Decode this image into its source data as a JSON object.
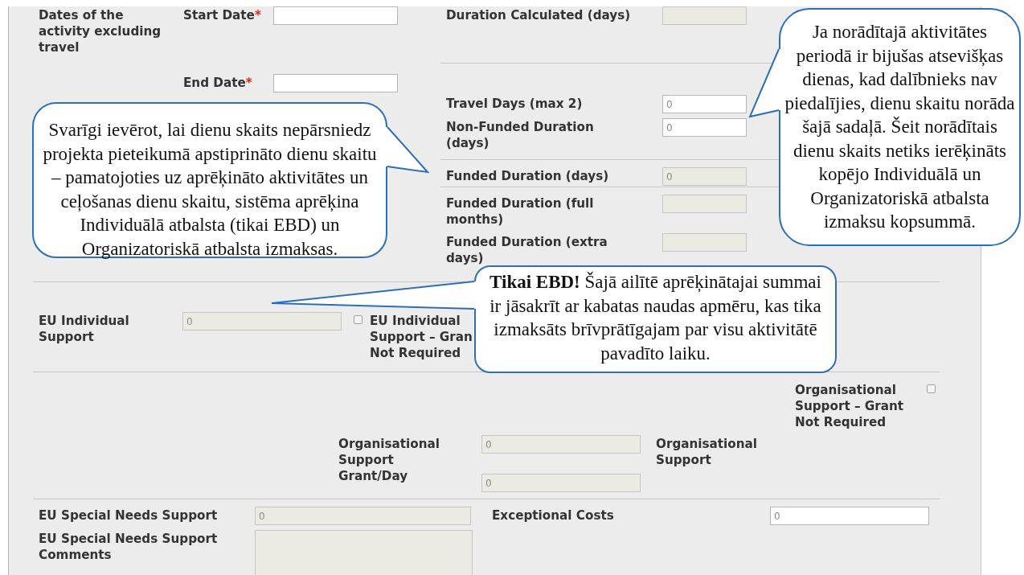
{
  "dates": {
    "label": "Dates of the activity excluding travel",
    "fields": [
      {
        "label": "Start Date",
        "required_mark": "*",
        "disabled": false
      },
      {
        "label": "End Date",
        "required_mark": "*",
        "disabled": false
      }
    ]
  },
  "duration": {
    "groups": [
      [
        {
          "label": "Duration Calculated (days)",
          "disabled": true
        }
      ],
      [
        {
          "label": "Travel Days (max 2)",
          "value": "0",
          "disabled": false
        },
        {
          "label": "Non-Funded Duration (days)",
          "value": "0",
          "disabled": false
        }
      ],
      [
        {
          "label": "Funded Duration (days)",
          "value": "0",
          "disabled": true
        }
      ],
      [
        {
          "label": "Funded Duration (full months)",
          "disabled": true
        },
        {
          "label": "Funded Duration (extra days)",
          "disabled": true
        }
      ]
    ]
  },
  "individual_support": {
    "label": "EU Individual Support",
    "value": "0",
    "disabled": true,
    "checkbox": {
      "label": "EU Individual Support – Gran Not Required",
      "checked": false
    }
  },
  "organisational_support": {
    "checkbox": {
      "label": "Organisational Support – Grant Not Required",
      "checked": false
    },
    "grant_per_day": {
      "label": "Organisational Support Grant/Day",
      "value": "0",
      "disabled": true
    },
    "support": {
      "label": "Organisational Support",
      "value": "0",
      "disabled": true
    }
  },
  "special_needs": {
    "label": "EU Special Needs Support",
    "value": "0",
    "disabled": true
  },
  "exceptional_costs": {
    "label": "Exceptional Costs",
    "value": "0",
    "disabled": false
  },
  "comments": {
    "label": "EU Special Needs Support Comments",
    "disabled": true
  },
  "callouts": [
    {
      "text": "Svarīgi ievērot, lai dienu skaits nepārsniedz projekta pieteikumā apstiprināto dienu skaitu – pamatojoties uz aprēķināto aktivitātes un ceļošanas dienu skaitu, sistēma aprēķina Individuālā atbalsta (tikai EBD) un Organizatoriskā atbalsta izmaksas."
    },
    {
      "text": "Ja norādītajā aktivitātes periodā ir bijušas atsevišķas dienas, kad dalībnieks nav piedalījies, dienu skaitu norāda šajā sadaļā. Šeit norādītais dienu skaits netiks ierēķināts kopējo Individuālā un Organizatoriskā atbalsta izmaksu kopsummā."
    },
    {
      "text": "**Tikai EBD!** Šajā ailītē aprēķinātajai summai ir jāsakrīt ar kabatas naudas apmēru, kas tika izmaksāts brīvprātīgajam par visu aktivitātē pavadīto laiku."
    }
  ]
}
